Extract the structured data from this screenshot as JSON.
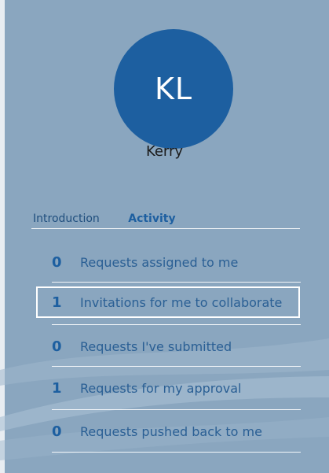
{
  "profile": {
    "initials": "KL",
    "name": "Kerry"
  },
  "tabs": [
    {
      "label": "Introduction"
    },
    {
      "label": "Activity",
      "selected": true
    }
  ],
  "activity": [
    {
      "count": "0",
      "label": "Requests assigned to me"
    },
    {
      "count": "1",
      "label": "Invitations for me to collaborate",
      "highlighted": true
    },
    {
      "count": "0",
      "label": "Requests I've submitted"
    },
    {
      "count": "1",
      "label": "Requests for my approval"
    },
    {
      "count": "0",
      "label": "Requests pushed back to me"
    }
  ],
  "colors": {
    "background": "#8aa6bf",
    "accent": "#1d5fa0",
    "link_text": "#2a5f94",
    "divider": "#f3f6f9"
  }
}
